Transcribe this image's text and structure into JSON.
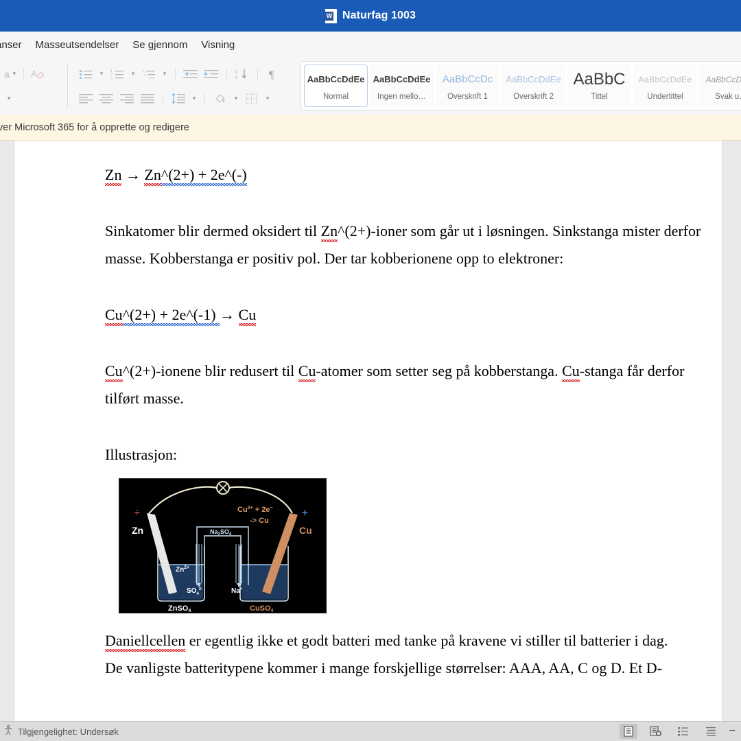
{
  "titlebar": {
    "doc_icon": "word-document-icon",
    "title": "Naturfag 1003"
  },
  "ribbon": {
    "tabs": [
      {
        "label": "anser",
        "name": "tab-referanser",
        "selected": false
      },
      {
        "label": "Masseutsendelser",
        "name": "tab-masseutsendelser",
        "selected": false
      },
      {
        "label": "Se gjennom",
        "name": "tab-se-gjennom",
        "selected": false
      },
      {
        "label": "Visning",
        "name": "tab-visning",
        "selected": false
      }
    ],
    "cut_label": "a",
    "tools_row1": [
      "bullet-list-icon",
      "chevron-down-icon",
      "numbered-list-icon",
      "chevron-down-icon",
      "multilevel-list-icon",
      "chevron-down-icon",
      "decrease-indent-icon",
      "increase-indent-icon",
      "sort-icon",
      "show-formatting-marks-icon"
    ],
    "tools_row2": [
      "align-left-icon",
      "align-center-icon",
      "align-right-icon",
      "justify-icon",
      "line-spacing-icon",
      "chevron-down-icon",
      "shading-icon",
      "chevron-down-icon",
      "borders-icon",
      "chevron-down-icon"
    ],
    "clear_formatting_icon": "clear-formatting-icon"
  },
  "styles": {
    "items": [
      {
        "preview": "AaBbCcDdEe",
        "name": "Normal",
        "cls": "sp-normal",
        "selected": true
      },
      {
        "preview": "AaBbCcDdEe",
        "name": "Ingen mello…",
        "cls": "sp-nospace",
        "selected": false
      },
      {
        "preview": "AaBbCcDc",
        "name": "Overskrift 1",
        "cls": "sp-h1",
        "selected": false
      },
      {
        "preview": "AaBbCcDdEe",
        "name": "Overskrift 2",
        "cls": "sp-h2",
        "selected": false
      },
      {
        "preview": "AaBbC",
        "name": "Tittel",
        "cls": "sp-title",
        "selected": false
      },
      {
        "preview": "AaBbCcDdEe",
        "name": "Undertittel",
        "cls": "sp-sub",
        "selected": false
      },
      {
        "preview": "AaBbCcDdEe",
        "name": "Svak u…",
        "cls": "sp-weak",
        "selected": false
      }
    ]
  },
  "notification": {
    "text": "ver Microsoft 365 for å opprette og redigere"
  },
  "document": {
    "eq1": {
      "zn": "Zn",
      "arrow": "→",
      "zn2": "Zn",
      "rest": "^(2+) + 2e^(-)"
    },
    "para1_a": "Sinkatomer blir dermed oksidert til ",
    "para1_zn": "Zn",
    "para1_b": "^(2+)-ioner som går ut i løsningen. Sinkstanga mister derfor masse. Kobberstanga er positiv pol. Der tar kobberionene opp to elektroner:",
    "eq2": {
      "cu": "Cu",
      "mid": "^(2+) + 2e^(-1) ",
      "arrow": "→",
      "cu2": "Cu"
    },
    "para2_cu": "Cu",
    "para2_a": "^(2+)-ionene blir redusert til ",
    "para2_cu2": "Cu",
    "para2_b": "-atomer som setter seg på kobberstanga. ",
    "para2_cu3": "Cu",
    "para2_c": "-stanga får derfor tilført masse.",
    "illustration_label": "Illustrasjon:",
    "para3_daniell": "Daniellcellen",
    "para3_rest": " er egentlig ikke et godt batteri med tanke på kravene vi stiller til batterier i dag.",
    "para4": "De vanligste batteritypene kommer i mange forskjellige størrelser: AAA, AA, C og D. Et D-"
  },
  "figure": {
    "name": "daniell-cell-diagram",
    "labels": {
      "zn_electrode": "Zn",
      "cu_electrode": "Cu",
      "minus": "÷",
      "plus": "+",
      "reaction_line1_a": "Cu",
      "reaction_line1_sup": "2+",
      "reaction_line1_b": "+ 2e",
      "reaction_line1_sup2": "−",
      "reaction_line2": "->  Cu",
      "salt_bridge": "Na",
      "salt_bridge_sub": "2",
      "salt_bridge_b": "SO",
      "salt_bridge_sub2": "4",
      "zn_ion": "Zn",
      "zn_ion_sup": "2+",
      "so4_ion": "SO",
      "so4_sub": "4",
      "so4_sup": "2-",
      "na_ion": "Na",
      "na_sup": "+",
      "beaker_left": "ZnSO",
      "beaker_left_sub": "4",
      "beaker_right": "CuSO",
      "beaker_right_sub": "4"
    },
    "colors": {
      "background": "#000000",
      "solution": "#1e3a5f",
      "beaker_line": "#cfe3f5",
      "zn_bar": "#e8e8e8",
      "cu_bar": "#cf8f62",
      "wire": "#efe8d0",
      "reaction_text": "#d79a6a",
      "minus_color": "#d94b4b",
      "plus_color": "#4b7fd9"
    }
  },
  "statusbar": {
    "accessibility_icon": "accessibility-icon",
    "accessibility_text": "Tilgjengelighet: Undersøk",
    "views": [
      {
        "name": "read-mode-icon",
        "active": true
      },
      {
        "name": "print-layout-icon",
        "active": false
      },
      {
        "name": "web-layout-icon",
        "active": false
      },
      {
        "name": "outline-icon",
        "active": false
      }
    ],
    "zoom_out": "−"
  },
  "colors": {
    "titlebar": "#1a5bb8",
    "ribbon": "#f6f6f6",
    "notification": "#fdf6e3",
    "canvas": "#e9e9e9",
    "statusbar": "#dcdcdc"
  }
}
